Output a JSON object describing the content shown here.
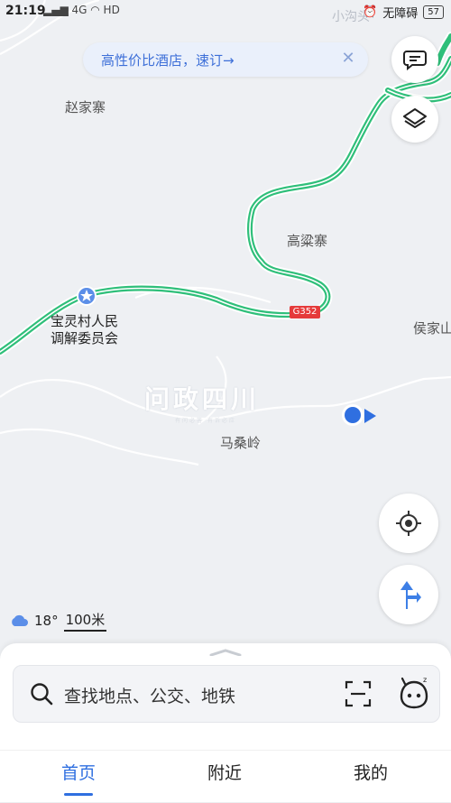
{
  "status_bar": {
    "time": "21:19",
    "network": "4G",
    "hd": "HD",
    "accessibility": "无障碍",
    "battery": "57"
  },
  "promo": {
    "text": "高性价比酒店，速订→",
    "close_icon": "close-icon"
  },
  "map": {
    "places": {
      "zhaojiazhai": "赵家寨",
      "gaoliangzhai": "高粱寨",
      "baoling": [
        "宝灵村人民",
        "调解委员会"
      ],
      "houjiashan": "侯家山",
      "masangling": "马桑岭",
      "top_faded": "小沟头"
    },
    "route_number": "G352",
    "watermark": {
      "title": "问政四川",
      "subtitle": "有问必答  有诉必应"
    },
    "weather": {
      "icon": "cloud-icon",
      "temperature": "18°"
    },
    "scale": "100米",
    "colors": {
      "road": "#2fbf7a",
      "road_edge": "#ffffff",
      "location": "#2f6fe0",
      "accent": "#2f6fe0",
      "background": "#eef0f3"
    }
  },
  "controls": {
    "message": "message-icon",
    "layers": "layers-icon",
    "locate": "locate-icon",
    "navigate": "navigate-icon"
  },
  "search": {
    "placeholder": "查找地点、公交、地铁",
    "scan": "scan-icon",
    "assistant": "assistant-icon"
  },
  "tabs": [
    {
      "label": "首页",
      "active": true
    },
    {
      "label": "附近",
      "active": false
    },
    {
      "label": "我的",
      "active": false
    }
  ]
}
